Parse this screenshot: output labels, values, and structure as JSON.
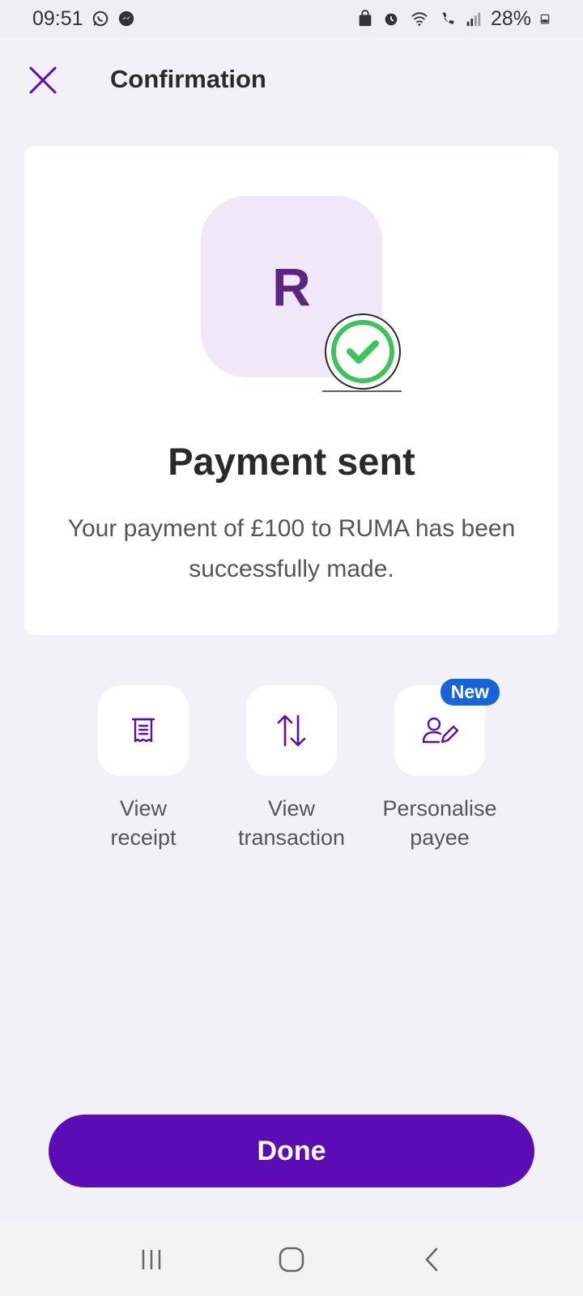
{
  "status_bar": {
    "time": "09:51",
    "battery": "28%",
    "left_icons": [
      "whatsapp-icon",
      "messenger-icon"
    ],
    "right_icons": [
      "bag-icon",
      "alarm-icon",
      "wifi-icon",
      "wifi-calling-icon",
      "signal-icon",
      "battery-icon"
    ]
  },
  "header": {
    "title": "Confirmation",
    "close_icon": "close-icon"
  },
  "card": {
    "avatar_letter": "R",
    "title": "Payment sent",
    "description": "Your payment of £100 to RUMA has been successfully made."
  },
  "actions": [
    {
      "label": "View receipt",
      "icon": "receipt-icon"
    },
    {
      "label": "View transaction",
      "icon": "transfer-arrows-icon"
    },
    {
      "label": "Personalise payee",
      "icon": "edit-person-icon",
      "badge": "New"
    }
  ],
  "done_button": {
    "label": "Done"
  },
  "colors": {
    "accent": "#5b0cb4",
    "avatar_bg": "#f0e8f8",
    "avatar_text": "#5b2583",
    "success": "#3cc35c",
    "badge": "#1664d8"
  }
}
